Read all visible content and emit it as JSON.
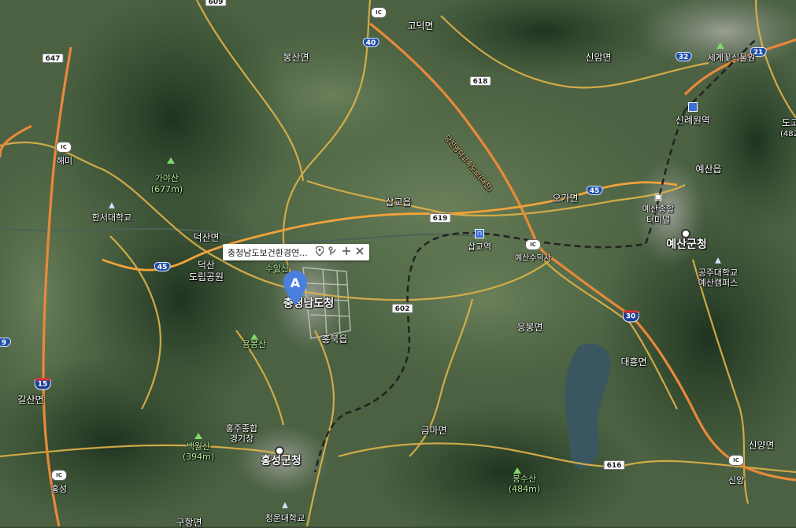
{
  "map": {
    "type": "satellite",
    "place_labels": {
      "gaya_san": "가야산",
      "gaya_san_elev": "(677m)",
      "haemi": "해미",
      "hanseo_univ": "한서대학교",
      "deoksan_myeon": "덕산면",
      "deoksan_park_1": "덕산",
      "deoksan_park_2": "도립공원",
      "suam_san": "수암산",
      "yongbong_san": "용봉산",
      "hongbuk_eup": "홍북읍",
      "provincial_office": "충청남도청",
      "bongsan_myeon": "봉산면",
      "godeok_myeon": "고덕면",
      "sinam_myeon": "신암면",
      "sapgyo_eup": "삽교읍",
      "sapgyo_station": "삽교역",
      "ogamyeon": "오가면",
      "yesan_sudeoksa": "예산수덕사",
      "yesan_terminal_1": "예산종합",
      "yesan_terminal_2": "터미널",
      "yesan_county": "예산군청",
      "sinrye_won_station": "신례원역",
      "yesan_eup": "예산읍",
      "segye_flower": "세계꽃식물원",
      "kongju_univ_1": "공주대학교",
      "kongju_univ_2": "예산캠퍼스",
      "eungbong_myeon": "응봉면",
      "daeheung_myeon": "대흥면",
      "geumma_myeon": "금마면",
      "hongju_stadium_1": "홍주종합",
      "hongju_stadium_2": "경기장",
      "baegwol_san": "백월산",
      "baegwol_san_elev": "(394m)",
      "hongseong_county": "홍성군청",
      "bongsu_san": "봉수산",
      "bongsu_san_elev": "(484m)",
      "galsan_myeon": "갈산면",
      "hongseong": "홍성",
      "cheongun_univ": "청운대학교",
      "sinyang_myeon": "신양면",
      "sinyang": "신양",
      "gu_hang_myeon": "구항면",
      "dogo": "도고",
      "dogo_num": "(482",
      "expressway_name": "당진영덕고속도로(대전)"
    },
    "route_shields": [
      {
        "id": "r609",
        "label": "609",
        "kind": "loc"
      },
      {
        "id": "r647",
        "label": "647",
        "kind": "loc"
      },
      {
        "id": "r40",
        "label": "40",
        "kind": "nat"
      },
      {
        "id": "r618",
        "label": "618",
        "kind": "loc"
      },
      {
        "id": "r32",
        "label": "32",
        "kind": "nat"
      },
      {
        "id": "r21",
        "label": "21",
        "kind": "nat"
      },
      {
        "id": "r45a",
        "label": "45",
        "kind": "nat"
      },
      {
        "id": "r45b",
        "label": "45",
        "kind": "nat"
      },
      {
        "id": "r619",
        "label": "619",
        "kind": "loc"
      },
      {
        "id": "r602",
        "label": "602",
        "kind": "loc"
      },
      {
        "id": "r616",
        "label": "616",
        "kind": "loc"
      },
      {
        "id": "r15",
        "label": "15",
        "kind": "hwy"
      },
      {
        "id": "r30",
        "label": "30",
        "kind": "hwy"
      },
      {
        "id": "r9",
        "label": "9",
        "kind": "nat"
      }
    ],
    "interchange_label": "IC"
  },
  "popup": {
    "title": "충청남도보건환경연...",
    "pin_icon": "pin-icon",
    "route_icon": "route-icon",
    "zoom_icon": "plus-icon",
    "close_icon": "close-icon"
  },
  "marker": {
    "letter": "A",
    "color": "#4a7fe0"
  }
}
